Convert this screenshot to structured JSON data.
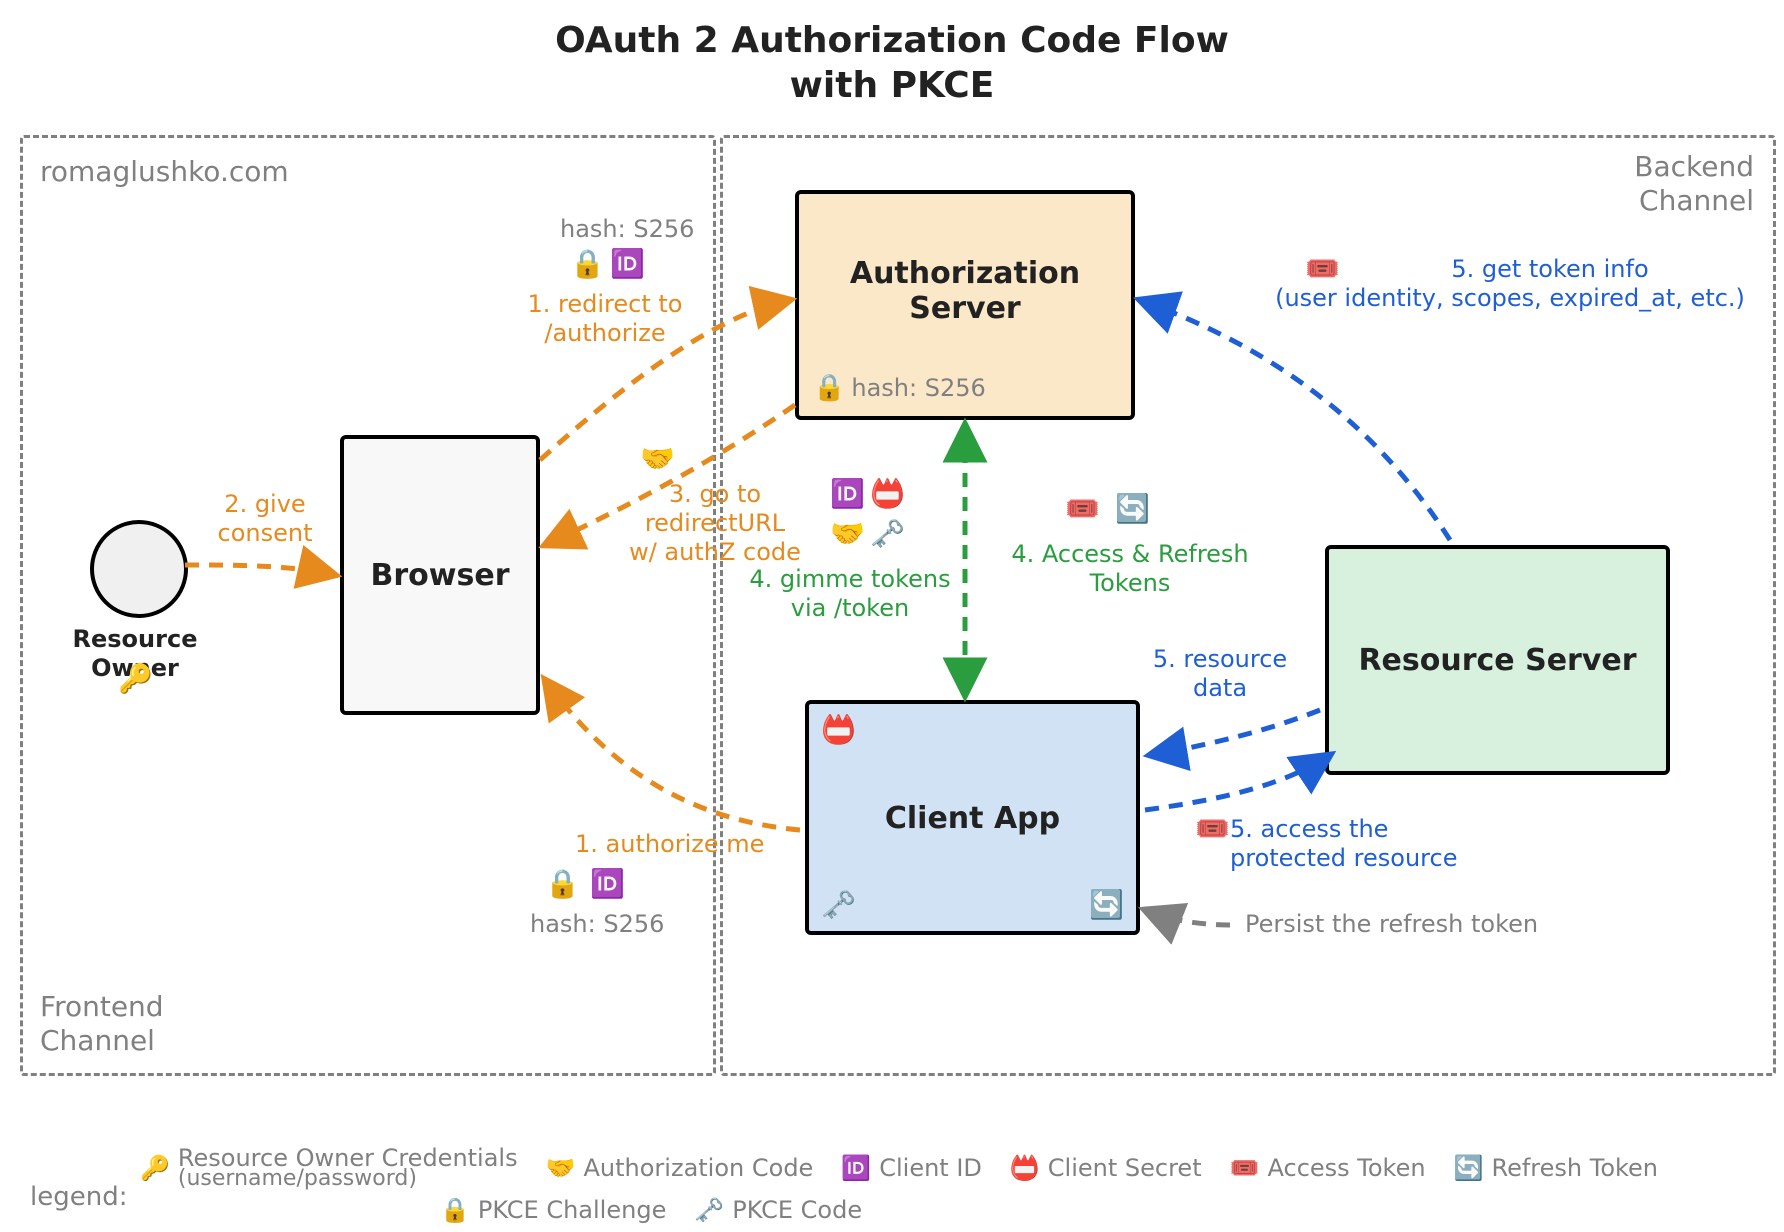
{
  "title_l1": "OAuth 2 Authorization Code Flow",
  "title_l2": "with PKCE",
  "regions": {
    "frontend": {
      "label_top": "romaglushko.com",
      "label_bottom_l1": "Frontend",
      "label_bottom_l2": "Channel"
    },
    "backend": {
      "label_l1": "Backend",
      "label_l2": "Channel"
    }
  },
  "nodes": {
    "resource_owner": "Resource Owner",
    "browser": "Browser",
    "auth_server_l1": "Authorization",
    "auth_server_l2": "Server",
    "client_app": "Client App",
    "resource_server": "Resource Server"
  },
  "steps": {
    "s1a_l1": "1. redirect to",
    "s1a_l2": "/authorize",
    "s1a_hash": "hash: S256",
    "s1b": "1. authorize me",
    "s1b_hash": "hash: S256",
    "s2_l1": "2. give",
    "s2_l2": "consent",
    "s3_l1": "3. go to",
    "s3_l2": "redirectURL",
    "s3_l3": "w/ authZ code",
    "s4a_l1": "4. gimme tokens",
    "s4a_l2": "via /token",
    "s4b_l1": "4. Access & Refresh",
    "s4b_l2": "Tokens",
    "s5a_l1": "5. get token info",
    "s5a_l2": "(user identity, scopes, expired_at, etc.)",
    "s5b_l1": "5. resource",
    "s5b_l2": "data",
    "s5c_l1": "5. access the",
    "s5c_l2": "protected resource",
    "persist": "Persist the refresh token"
  },
  "inline_labels": {
    "auth_hash": "hash: S256"
  },
  "icons": {
    "key": "🔑",
    "lock": "🔒",
    "id": "🆔",
    "handshake": "🤝",
    "client_key": "🗝️",
    "ticket": "🎟️",
    "refresh": "🔄",
    "badge": "📛"
  },
  "legend": {
    "label": "legend:",
    "items_row1": [
      {
        "icon": "🔑",
        "text": "Resource Owner Credentials",
        "sub": "(username/password)"
      },
      {
        "icon": "🤝",
        "text": "Authorization Code"
      },
      {
        "icon": "🆔",
        "text": "Client ID"
      },
      {
        "icon": "📛",
        "text": "Client Secret"
      },
      {
        "icon": "🎟️",
        "text": "Access Token"
      },
      {
        "icon": "🔄",
        "text": "Refresh Token"
      }
    ],
    "items_row2": [
      {
        "icon": "🔒",
        "text": "PKCE Challenge"
      },
      {
        "icon": "🗝️",
        "text": "PKCE Code"
      }
    ]
  }
}
